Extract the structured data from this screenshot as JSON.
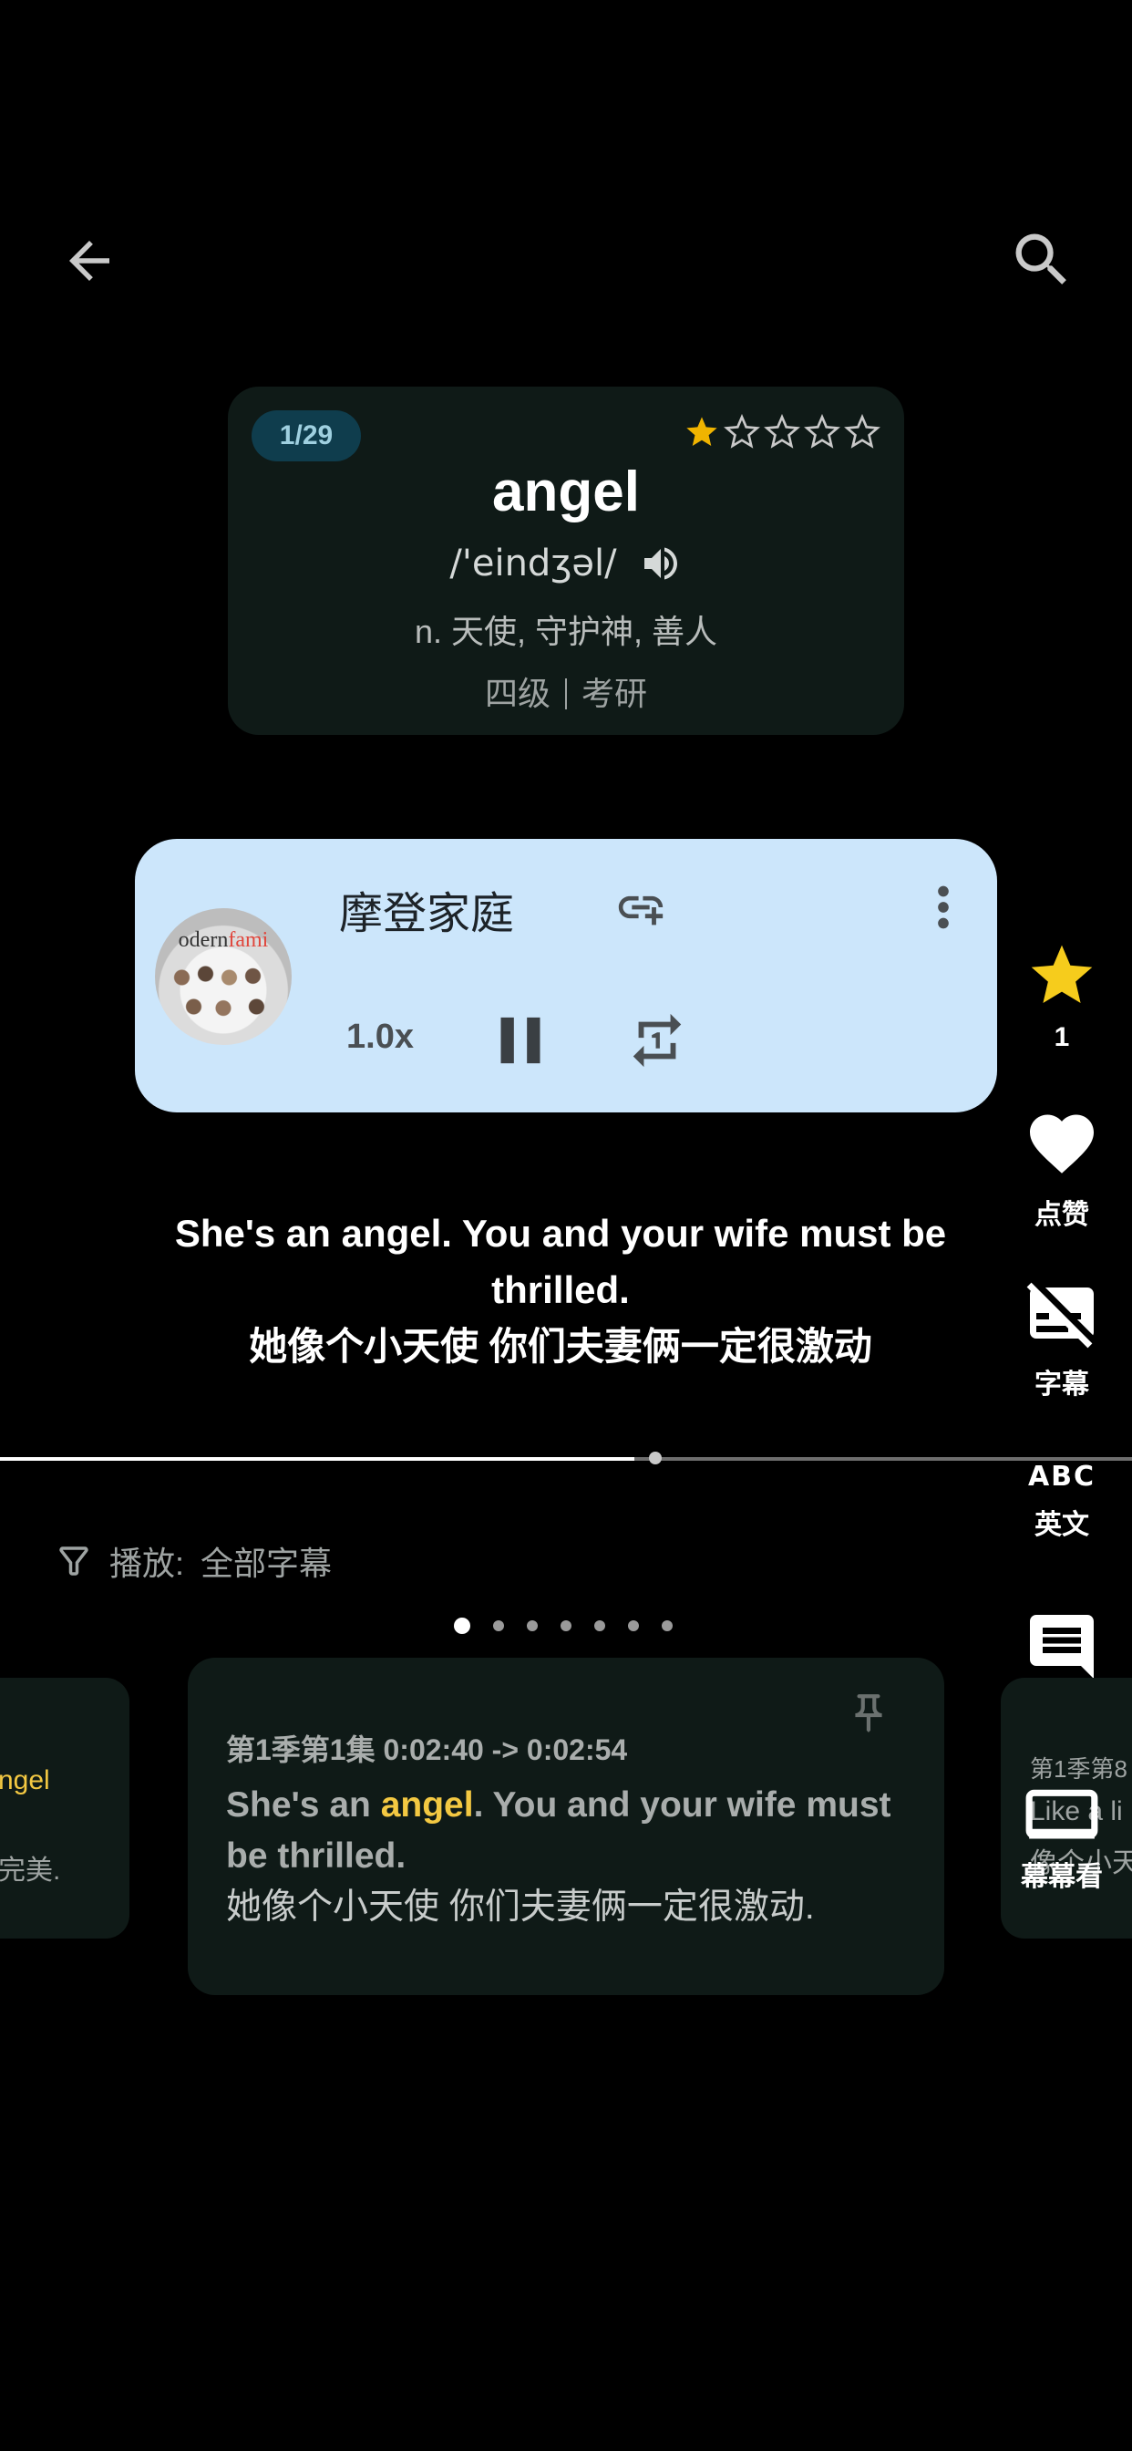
{
  "header": {
    "back_icon": "arrow-left-icon",
    "search_icon": "search-icon"
  },
  "word_card": {
    "counter": "1/29",
    "rating": 1,
    "rating_max": 5,
    "word": "angel",
    "phonetic": "/'eindʒəl/",
    "definition": "n. 天使, 守护神, 善人",
    "levels": [
      "四级",
      "考研"
    ],
    "star_color": "#f0b400"
  },
  "player": {
    "show_title": "摩登家庭",
    "cover_logo_a": "odern",
    "cover_logo_b": "fami",
    "speed": "1.0x",
    "background": "#cce6fb",
    "icons": [
      "link-add-icon",
      "more-vert-icon",
      "pause-icon",
      "repeat-one-icon"
    ]
  },
  "subtitle": {
    "english": "She's an angel. You and your wife must be thrilled.",
    "chinese": "她像个小天使  你们夫妻俩一定很激动"
  },
  "progress": {
    "fraction": 0.56
  },
  "rail": {
    "favorite_count": "1",
    "like_label": "点赞",
    "subtitle_label": "字幕",
    "abc_text": "ABC",
    "english_label": "英文",
    "comment_label": "评论",
    "screen_label": "幕幕看"
  },
  "filter": {
    "label": "播放:",
    "value": "全部字幕"
  },
  "pager": {
    "count": 7,
    "active": 0
  },
  "cards": {
    "left_partial": {
      "line1": "ngel",
      "line2": "完美."
    },
    "main": {
      "meta": "第1季第1集   0:02:40 -> 0:02:54",
      "before": "She's an ",
      "highlight": "angel",
      "after": ". You and your wife must be thrilled.",
      "chinese": "她像个小天使  你们夫妻俩一定很激动."
    },
    "right_partial": {
      "meta": "第1季第8",
      "line1": "Like a li",
      "line2": "像个小天"
    }
  }
}
